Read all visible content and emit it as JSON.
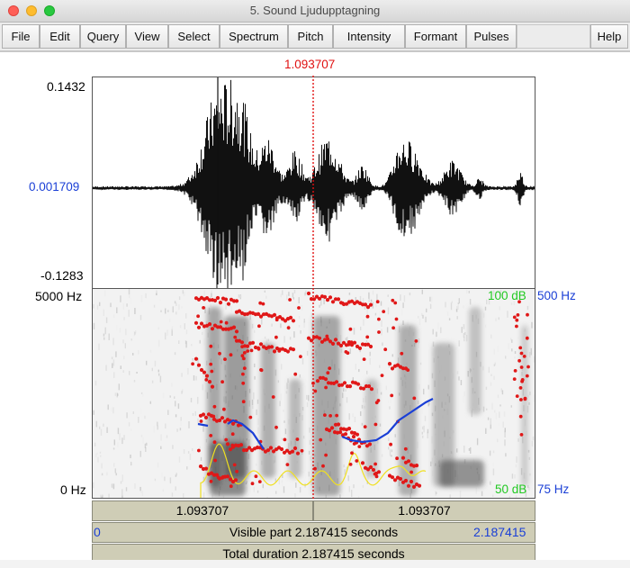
{
  "window": {
    "title": "5. Sound Ljudupptagning"
  },
  "menu": {
    "items": [
      "File",
      "Edit",
      "Query",
      "View",
      "Select",
      "Spectrum",
      "Pitch",
      "Intensity",
      "Formant",
      "Pulses"
    ],
    "help": "Help"
  },
  "cursor": {
    "time": "1.093707"
  },
  "waveform": {
    "max": "0.1432",
    "center": "0.001709",
    "min": "-0.1283"
  },
  "spectrogram": {
    "freq_top": "5000 Hz",
    "freq_bottom": "0 Hz",
    "intensity_top": "100 dB",
    "intensity_bottom": "50 dB",
    "pitch_top": "500 Hz",
    "pitch_bottom": "75 Hz"
  },
  "bars": {
    "left_part": "1.093707",
    "right_part": "1.093707",
    "visible_start": "0",
    "visible_label": "Visible part 2.187415 seconds",
    "visible_end": "2.187415",
    "total_label": "Total duration 2.187415 seconds"
  },
  "colors": {
    "cursor": "#e01010",
    "pitch": "#1a3fd6",
    "intensity": "#22c922",
    "formant": "#e01818",
    "bar": "#cfcdb6"
  }
}
